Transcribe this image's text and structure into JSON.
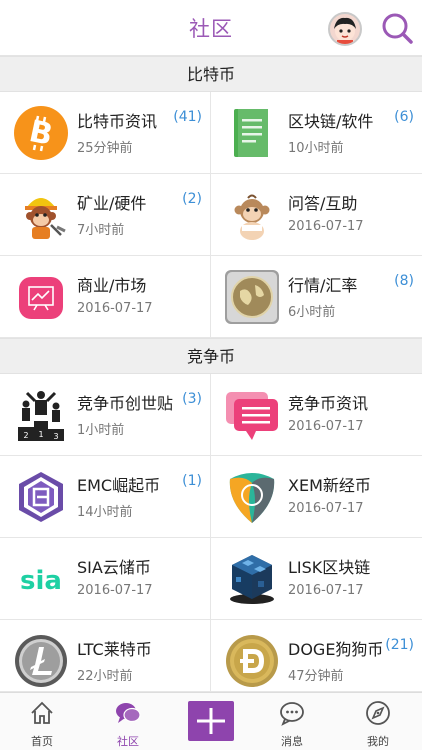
{
  "header": {
    "title": "社区",
    "avatar_icon": "user-avatar",
    "search_icon": "search-icon"
  },
  "sections": [
    {
      "title": "比特币",
      "items": [
        {
          "name": "比特币资讯",
          "time": "25分钟前",
          "count": "(41)",
          "icon": "bitcoin-icon"
        },
        {
          "name": "区块链/软件",
          "time": "10小时前",
          "count": "(6)",
          "icon": "document-icon"
        },
        {
          "name": "矿业/硬件",
          "time": "7小时前",
          "count": "(2)",
          "icon": "miner-monkey-icon"
        },
        {
          "name": "问答/互助",
          "time": "2016-07-17",
          "count": "",
          "icon": "baby-monkey-icon"
        },
        {
          "name": "商业/市场",
          "time": "2016-07-17",
          "count": "",
          "icon": "chart-board-icon"
        },
        {
          "name": "行情/汇率",
          "time": "6小时前",
          "count": "(8)",
          "icon": "globe-coin-icon"
        }
      ]
    },
    {
      "title": "竞争币",
      "items": [
        {
          "name": "竞争币创世贴",
          "time": "1小时前",
          "count": "(3)",
          "icon": "podium-icon"
        },
        {
          "name": "竞争币资讯",
          "time": "2016-07-17",
          "count": "",
          "icon": "chat-bubble-icon"
        },
        {
          "name": "EMC崛起币",
          "time": "14小时前",
          "count": "(1)",
          "icon": "emercoin-icon"
        },
        {
          "name": "XEM新经币",
          "time": "2016-07-17",
          "count": "",
          "icon": "nem-icon"
        },
        {
          "name": "SIA云储币",
          "time": "2016-07-17",
          "count": "",
          "icon": "sia-icon"
        },
        {
          "name": "LISK区块链",
          "time": "2016-07-17",
          "count": "",
          "icon": "lisk-cube-icon"
        },
        {
          "name": "LTC莱特币",
          "time": "22小时前",
          "count": "",
          "icon": "litecoin-icon"
        },
        {
          "name": "DOGE狗狗币",
          "time": "47分钟前",
          "count": "(21)",
          "icon": "dogecoin-icon"
        }
      ]
    }
  ],
  "tabbar": [
    {
      "label": "首页",
      "icon": "home-icon"
    },
    {
      "label": "社区",
      "icon": "community-chat-icon",
      "active": true
    },
    {
      "label": "",
      "icon": "plus-icon"
    },
    {
      "label": "消息",
      "icon": "message-icon"
    },
    {
      "label": "我的",
      "icon": "compass-icon"
    }
  ],
  "colors": {
    "accent": "#8e44ad",
    "count": "#3d8fd6",
    "section_bg": "#efefef"
  }
}
